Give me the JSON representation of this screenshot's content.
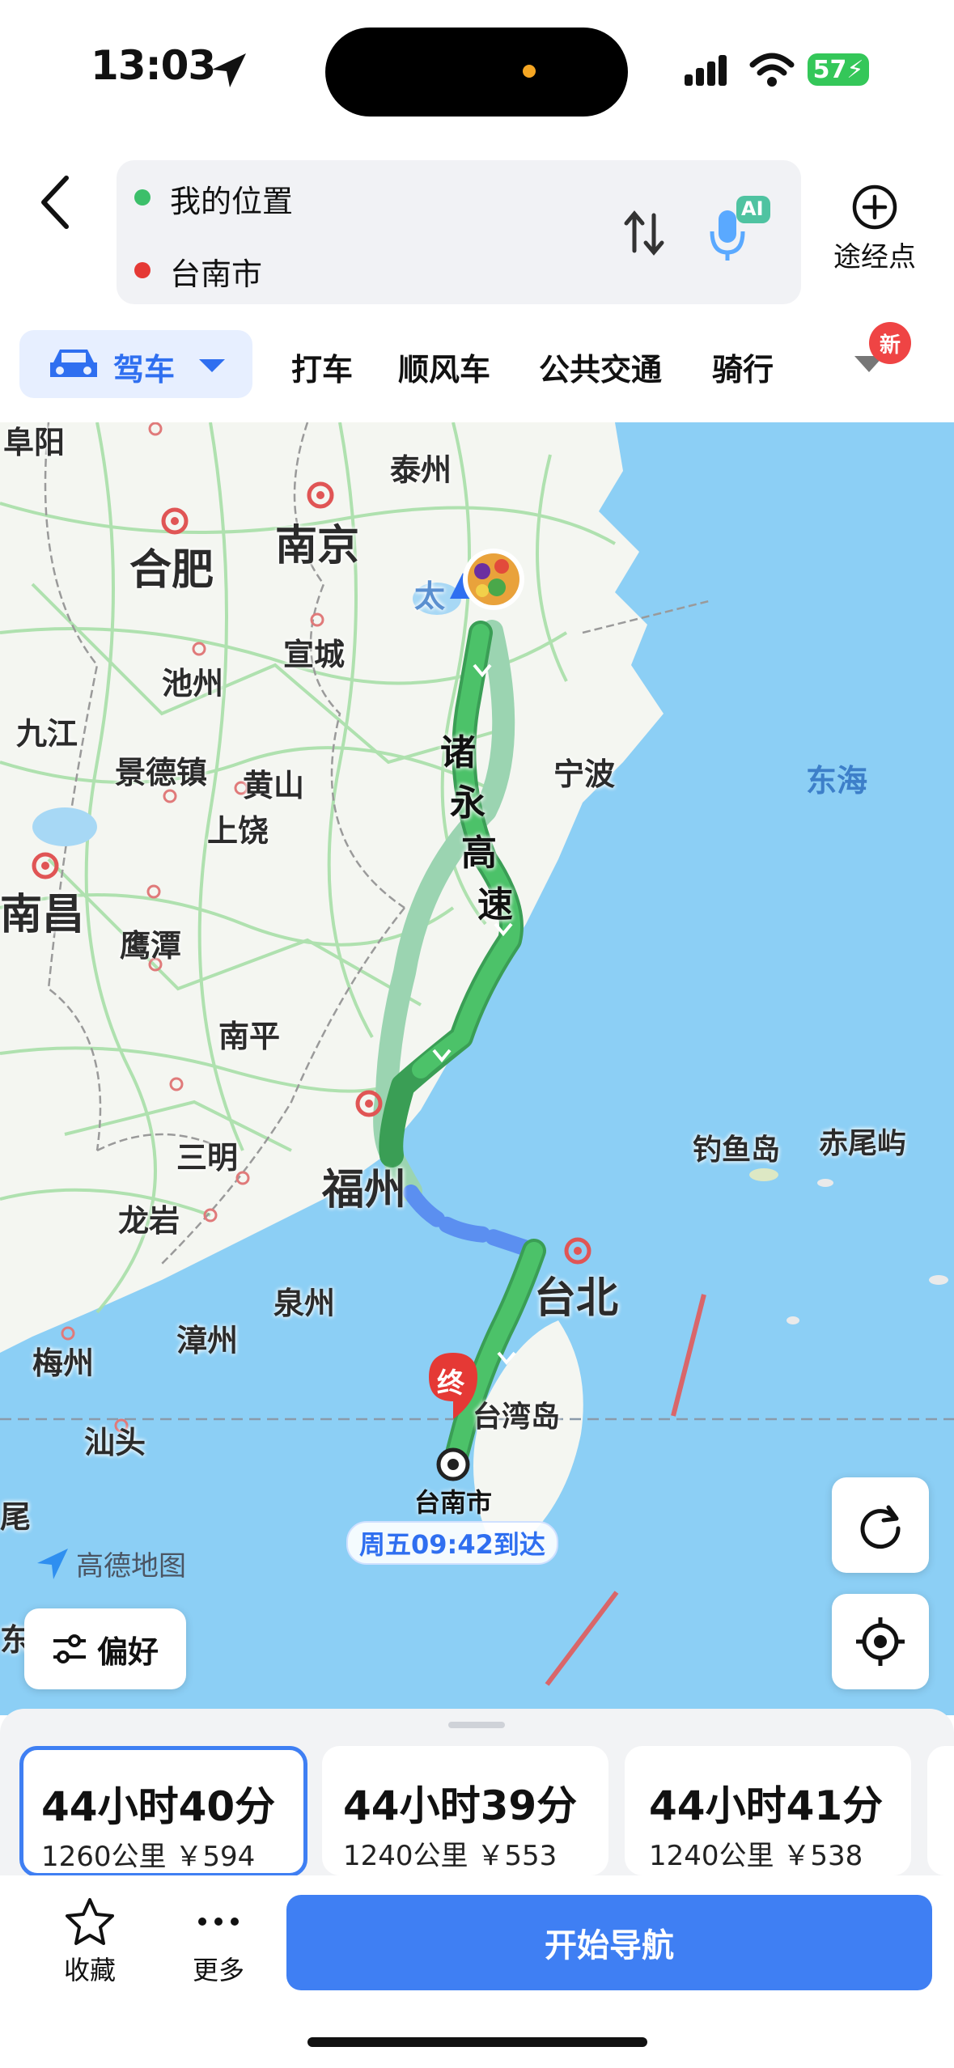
{
  "status": {
    "time": "13:03",
    "battery": "57"
  },
  "route": {
    "origin": "我的位置",
    "destination": "台南市",
    "origin_color": "#3cbf6a",
    "destination_color": "#e53935",
    "ai_label": "AI",
    "waypoint_label": "途经点"
  },
  "modes": {
    "active": "驾车",
    "tabs": [
      "打车",
      "顺风车",
      "公共交通",
      "骑行"
    ],
    "new_badge": "新"
  },
  "map": {
    "cities": [
      "阜阳",
      "泰州",
      "合肥",
      "南京",
      "太",
      "宣城",
      "池州",
      "九江",
      "景德镇",
      "黄山",
      "宁波",
      "上饶",
      "南昌",
      "鹰潭",
      "南平",
      "三明",
      "福州",
      "龙岩",
      "泉州",
      "漳州",
      "台北",
      "梅州",
      "台湾岛",
      "汕头",
      "尾",
      "东"
    ],
    "sea": "东海",
    "islands": [
      "钓鱼岛",
      "赤尾屿"
    ],
    "road_name": [
      "诸",
      "永",
      "高",
      "速"
    ],
    "destination_marker": "终",
    "destination_label": "台南市",
    "arrival": "周五09:42到达",
    "logo": "高德地图",
    "preference": "偏好"
  },
  "routes": [
    {
      "time": "44小时40分",
      "distance": "1260公里",
      "cost": "￥594",
      "selected": true
    },
    {
      "time": "44小时39分",
      "distance": "1240公里",
      "cost": "￥553",
      "selected": false
    },
    {
      "time": "44小时41分",
      "distance": "1240公里",
      "cost": "￥538",
      "selected": false
    }
  ],
  "footer": {
    "favorite": "收藏",
    "more": "更多",
    "start": "开始导航"
  },
  "colors": {
    "accent": "#3f7ff3",
    "route_green": "#3fb561",
    "land": "#f3f5f1",
    "water": "#8ccff5"
  }
}
